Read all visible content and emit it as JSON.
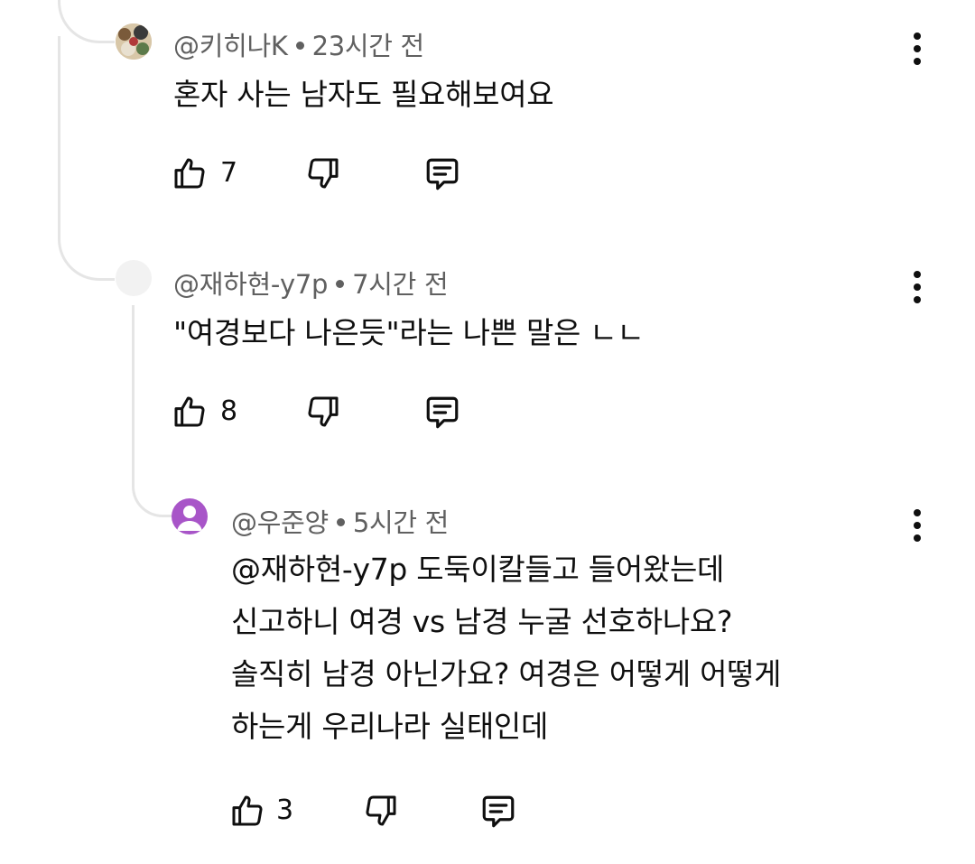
{
  "comments": [
    {
      "handle": "@키히나K",
      "time": "23시간 전",
      "lines": [
        "혼자 사는 남자도 필요해보여요"
      ],
      "likes": "7"
    },
    {
      "handle": "@재하현-y7p",
      "time": "7시간 전",
      "lines": [
        "\"여경보다 나은듯\"라는 나쁜 말은 ㄴㄴ"
      ],
      "likes": "8"
    },
    {
      "handle": "@우준양",
      "time": "5시간 전",
      "lines": [
        "@재하현-y7p  도둑이칼들고 들어왔는데",
        "신고하니  여경 vs  남경   누굴 선호하나요?",
        "솔직히  남경 아닌가요? 여경은 어떻게  어떻게",
        "하는게  우리나라 실태인데"
      ],
      "likes": "3"
    }
  ],
  "icons": {
    "like": "thumbs-up-icon",
    "dislike": "thumbs-down-icon",
    "reply": "reply-comment-icon",
    "menu": "more-vertical-icon"
  },
  "colors": {
    "text": "#0f0f0f",
    "meta": "#606060",
    "thread_line": "#e5e5e5",
    "avatar_purple": "#a855c8"
  }
}
